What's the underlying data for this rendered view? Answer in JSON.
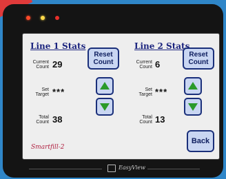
{
  "device": {
    "brand_label": "Smartfill-2",
    "maker_label": "EasyView"
  },
  "line1": {
    "title": "Line 1 Stats",
    "current_label": "Current Count",
    "current_value": "29",
    "target_label": "Set Target",
    "target_value": "***",
    "total_label": "Total Count",
    "total_value": "38",
    "reset_label": "Reset Count"
  },
  "line2": {
    "title": "Line 2 Stats",
    "current_label": "Current Count",
    "current_value": "6",
    "target_label": "Set Target",
    "target_value": "***",
    "total_label": "Total Count",
    "total_value": "13",
    "reset_label": "Reset Count"
  },
  "back_label": "Back",
  "icons": [
    "up-arrow-icon",
    "down-arrow-icon"
  ]
}
